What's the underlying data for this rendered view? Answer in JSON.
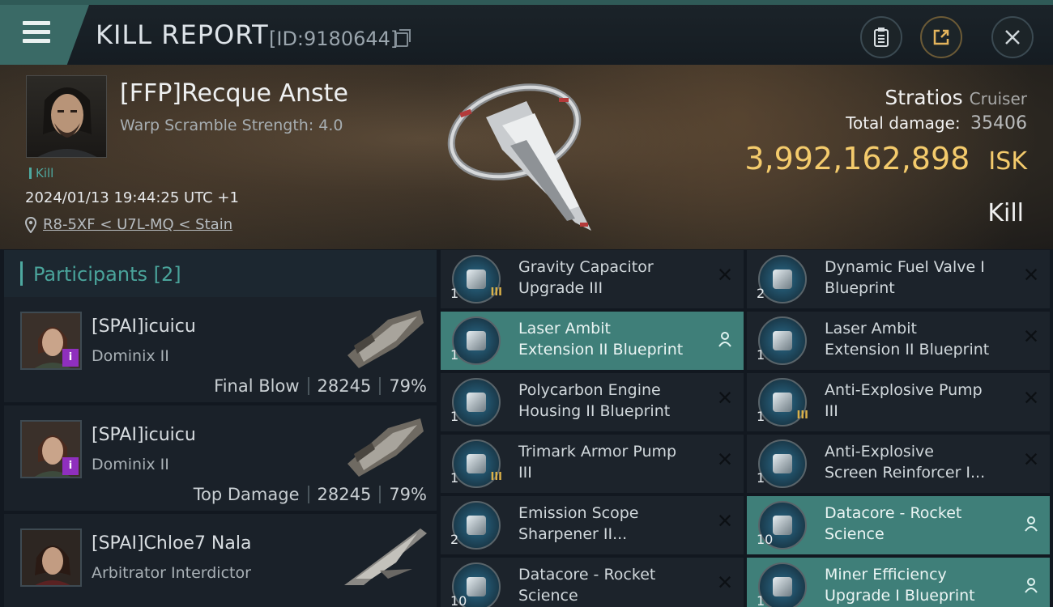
{
  "header": {
    "title": "KILL REPORT",
    "id_text": "[ID:9180644]",
    "buttons": [
      "clipboard",
      "share",
      "close"
    ]
  },
  "victim": {
    "name": "[FFP]Recque Anste",
    "warp": "Warp Scramble Strength: 4.0",
    "tag": "Kill",
    "datetime": "2024/01/13 19:44:25 UTC +1",
    "location": "R8-5XF < U7L-MQ < Stain",
    "ship": "Stratios",
    "ship_class": "Cruiser",
    "damage_label": "Total damage:",
    "damage_value": "35406",
    "isk_value": "3,992,162,898",
    "isk_currency": "ISK",
    "result": "Kill"
  },
  "participants": {
    "title": "Participants [2]",
    "rows": [
      {
        "name": "[SPAI]icuicu",
        "ship": "Dominix II",
        "role": "Final Blow",
        "damage": "28245",
        "pct": "79%"
      },
      {
        "name": "[SPAI]icuicu",
        "ship": "Dominix II",
        "role": "Top Damage",
        "damage": "28245",
        "pct": "79%"
      },
      {
        "name": "[SPAI]Chloe7 Nala",
        "ship": "Arbitrator Interdictor",
        "role": "",
        "damage": "",
        "pct": ""
      }
    ]
  },
  "items": [
    {
      "line1": "Gravity Capacitor",
      "line2": "Upgrade III",
      "qty": "1",
      "tier": "III",
      "selected": false
    },
    {
      "line1": "Dynamic Fuel Valve I",
      "line2": "Blueprint",
      "qty": "2",
      "tier": "",
      "selected": false
    },
    {
      "line1": "Laser Ambit",
      "line2": "Extension II Blueprint",
      "qty": "1",
      "tier": "",
      "selected": true
    },
    {
      "line1": "Laser Ambit",
      "line2": "Extension II Blueprint",
      "qty": "1",
      "tier": "",
      "selected": false
    },
    {
      "line1": "Polycarbon Engine",
      "line2": "Housing II Blueprint",
      "qty": "1",
      "tier": "",
      "selected": false
    },
    {
      "line1": "Anti-Explosive Pump",
      "line2": "III",
      "qty": "1",
      "tier": "III",
      "selected": false
    },
    {
      "line1": "Trimark Armor Pump",
      "line2": "III",
      "qty": "1",
      "tier": "III",
      "selected": false
    },
    {
      "line1": "Anti-Explosive",
      "line2": "Screen Reinforcer I...",
      "qty": "1",
      "tier": "",
      "selected": false
    },
    {
      "line1": "Emission Scope",
      "line2": "Sharpener II...",
      "qty": "2",
      "tier": "",
      "selected": false
    },
    {
      "line1": "Datacore - Rocket",
      "line2": "Science",
      "qty": "10",
      "tier": "",
      "selected": true
    },
    {
      "line1": "Datacore - Rocket",
      "line2": "Science",
      "qty": "10",
      "tier": "",
      "selected": false
    },
    {
      "line1": "Miner Efficiency",
      "line2": "Upgrade I Blueprint",
      "qty": "1",
      "tier": "",
      "selected": true
    }
  ],
  "colors": {
    "accent": "#4ea9a0",
    "isk": "#f4cb6c",
    "selected_row": "#3f7f79",
    "badge": "#8f2fbe"
  }
}
